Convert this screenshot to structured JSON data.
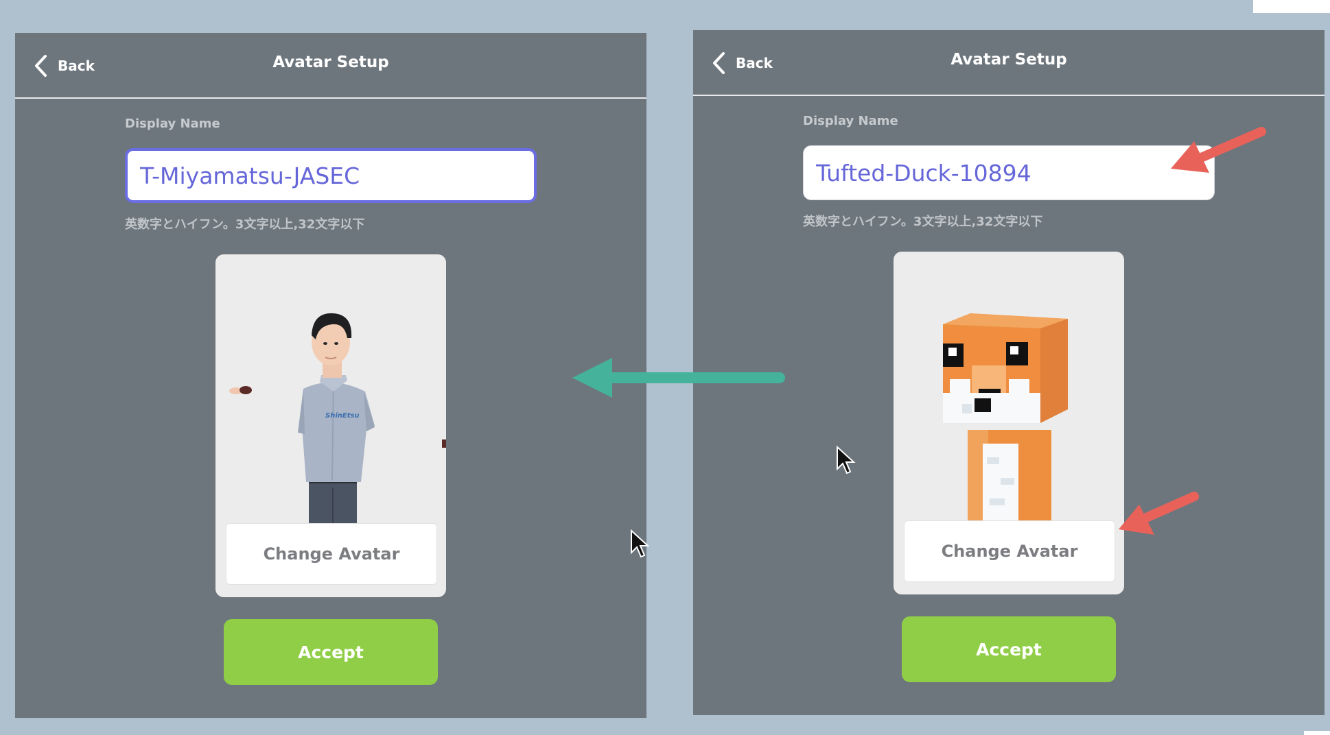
{
  "left_panel": {
    "back_label": "Back",
    "title": "Avatar Setup",
    "display_name_label": "Display Name",
    "display_name_value": "T-Miyamatsu-JASEC",
    "hint": "英数字とハイフン。3文字以上,32文字以下",
    "change_avatar_label": "Change Avatar",
    "accept_label": "Accept",
    "avatar": "human-avatar-in-shirt"
  },
  "right_panel": {
    "back_label": "Back",
    "title": "Avatar Setup",
    "display_name_label": "Display Name",
    "display_name_value": "Tufted-Duck-10894",
    "hint": "英数字とハイフン。3文字以上,32文字以下",
    "change_avatar_label": "Change Avatar",
    "accept_label": "Accept",
    "avatar": "blocky-fox-avatar"
  },
  "colors": {
    "panel_bg": "#6e767d",
    "accept_green": "#8fce46",
    "input_text": "#6566d8",
    "input_focus_border": "#6b6de3",
    "annotation_red": "#e8625a",
    "annotation_teal": "#45b39c"
  },
  "annotations": {
    "teal_arrow": "arrow-left-icon",
    "red_arrows": [
      "arrow-to-name-field-icon",
      "arrow-to-change-avatar-icon"
    ]
  }
}
